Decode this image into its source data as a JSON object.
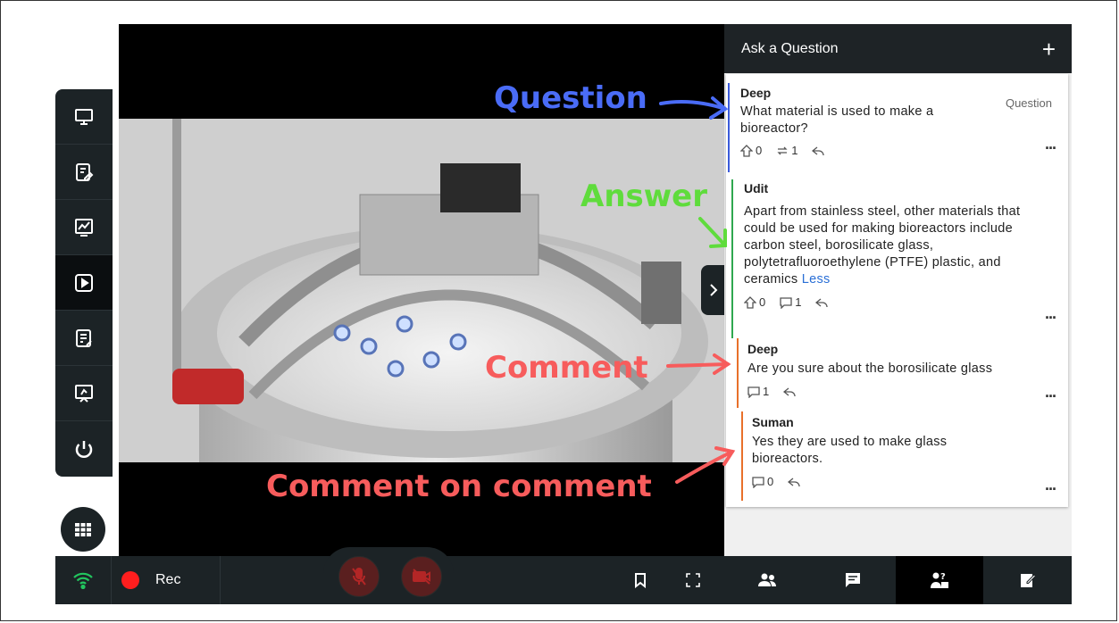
{
  "panel": {
    "title": "Ask a Question",
    "add_icon": "plus-icon",
    "collapse_icon": "chevron-right-icon"
  },
  "thread": {
    "question": {
      "author": "Deep",
      "tag": "Question",
      "text": "What material is used to make a bioreactor?",
      "upvotes": "0",
      "replies": "1"
    },
    "answer": {
      "author": "Udit",
      "text": "Apart from stainless steel, other materials that could be used for making bioreactors include carbon steel, borosilicate glass, polytetrafluoroethylene (PTFE) plastic, and ceramics",
      "less_link": "Less",
      "upvotes": "0",
      "comments": "1"
    },
    "comment": {
      "author": "Deep",
      "text": "Are you sure about the borosilicate glass",
      "comments": "1"
    },
    "reply": {
      "author": "Suman",
      "text": "Yes they are used to make glass bioreactors.",
      "comments": "0"
    },
    "more_label": "..."
  },
  "annotations": {
    "question": "Question",
    "answer": "Answer",
    "comment": "Comment",
    "comment_on_comment": "Comment on comment"
  },
  "bottombar": {
    "rec_label": "Rec",
    "icons": [
      "wifi-icon",
      "record-icon",
      "mic-off-icon",
      "video-off-icon",
      "bookmark-icon",
      "fullscreen-icon",
      "participants-icon",
      "chat-icon",
      "qna-icon",
      "notes-icon"
    ]
  },
  "sidebar": {
    "icons": [
      "whiteboard-icon",
      "document-edit-icon",
      "analytics-icon",
      "play-icon",
      "notes-icon",
      "presentation-icon",
      "power-icon"
    ],
    "active_index": 3
  },
  "colors": {
    "question_accent": "#3b5bdb",
    "answer_accent": "#2fa84f",
    "comment_accent": "#e8702a",
    "anno_blue": "#4a6cf7",
    "anno_green": "#5fdc3c",
    "anno_red": "#f75c5c",
    "dark_bar": "#1c2326"
  }
}
